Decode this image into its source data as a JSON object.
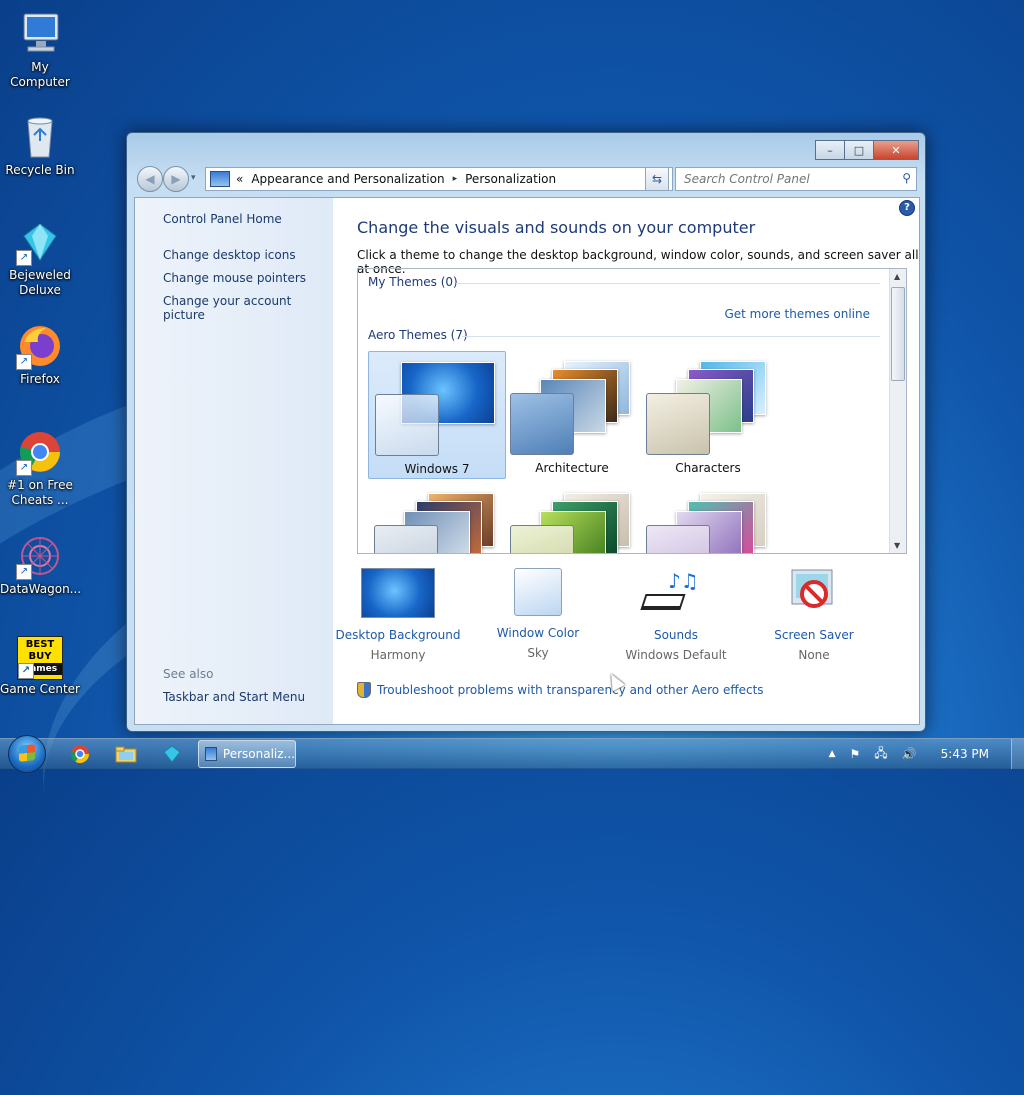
{
  "desktop": {
    "icons": [
      {
        "label": "My Computer",
        "icon": "computer-icon"
      },
      {
        "label": "Recycle Bin",
        "icon": "recycle-bin-icon"
      },
      {
        "label": "Bejeweled Deluxe",
        "icon": "gem-icon"
      },
      {
        "label": "Firefox",
        "icon": "firefox-icon"
      },
      {
        "label": "#1 on Free Cheats ...",
        "icon": "chrome-icon"
      },
      {
        "label": "DataWagon...",
        "icon": "datawagon-icon"
      },
      {
        "label": "Game Center",
        "icon": "game-center-icon"
      }
    ],
    "best_buy_logo": {
      "line1": "BEST",
      "line2": "BUY",
      "line3": "Games"
    }
  },
  "window": {
    "controls": {
      "minimize": "–",
      "maximize": "□",
      "close": "✕"
    },
    "address": {
      "overflow": "«",
      "crumbs": [
        "Appearance and Personalization",
        "Personalization"
      ],
      "separator": "▸",
      "dropdown": "▾"
    },
    "search_placeholder": "Search Control Panel",
    "left_pane": {
      "home": "Control Panel Home",
      "links": [
        "Change desktop icons",
        "Change mouse pointers",
        "Change your account picture"
      ],
      "see_also": "See also",
      "see_also_links": [
        "Taskbar and Start Menu"
      ]
    },
    "main": {
      "help": "?",
      "title": "Change the visuals and sounds on your computer",
      "subtitle": "Click a theme to change the desktop background, window color, sounds, and screen saver all at once.",
      "my_themes": "My Themes (0)",
      "get_more": "Get more themes online",
      "aero_themes": "Aero Themes (7)",
      "themes": [
        "Windows 7",
        "Architecture",
        "Characters",
        "",
        "",
        ""
      ],
      "options": [
        {
          "name": "Desktop Background",
          "value": "Harmony"
        },
        {
          "name": "Window Color",
          "value": "Sky"
        },
        {
          "name": "Sounds",
          "value": "Windows Default"
        },
        {
          "name": "Screen Saver",
          "value": "None"
        }
      ],
      "troubleshoot": "Troubleshoot problems with transparency and other Aero effects"
    }
  },
  "taskbar": {
    "active_task": "Personaliz...",
    "clock": "5:43 PM",
    "tray_arrow": "▲"
  },
  "colors": {
    "link": "#1e5aa8",
    "title": "#1e3a78",
    "selection": "#c4ddf6"
  }
}
